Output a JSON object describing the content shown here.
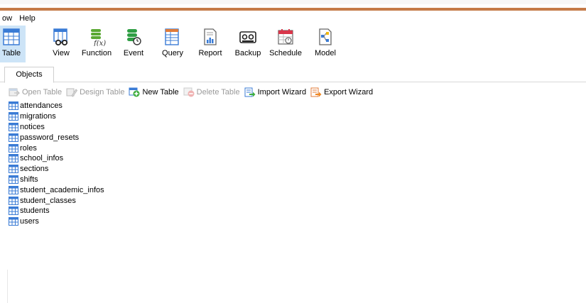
{
  "menu": [
    "ow",
    "Help"
  ],
  "ribbon": {
    "buttons": [
      {
        "label": "Table",
        "icon": "table-icon",
        "active": true
      },
      {
        "label": "View",
        "icon": "view-icon"
      },
      {
        "label": "Function",
        "icon": "function-icon"
      },
      {
        "label": "Event",
        "icon": "event-icon"
      },
      {
        "label": "Query",
        "icon": "query-icon"
      },
      {
        "label": "Report",
        "icon": "report-icon"
      },
      {
        "label": "Backup",
        "icon": "backup-icon"
      },
      {
        "label": "Schedule",
        "icon": "schedule-icon"
      },
      {
        "label": "Model",
        "icon": "model-icon"
      }
    ]
  },
  "tabs": {
    "objects": "Objects"
  },
  "toolbar": {
    "open_table": "Open Table",
    "design_table": "Design Table",
    "new_table": "New Table",
    "delete_table": "Delete Table",
    "import_wizard": "Import Wizard",
    "export_wizard": "Export Wizard"
  },
  "tables": [
    "attendances",
    "migrations",
    "notices",
    "password_resets",
    "roles",
    "school_infos",
    "sections",
    "shifts",
    "student_academic_infos",
    "student_classes",
    "students",
    "users"
  ],
  "colors": {
    "accent": "#c57a48",
    "active_tab": "#cde4f7",
    "disabled_text": "#9a9a9a"
  }
}
